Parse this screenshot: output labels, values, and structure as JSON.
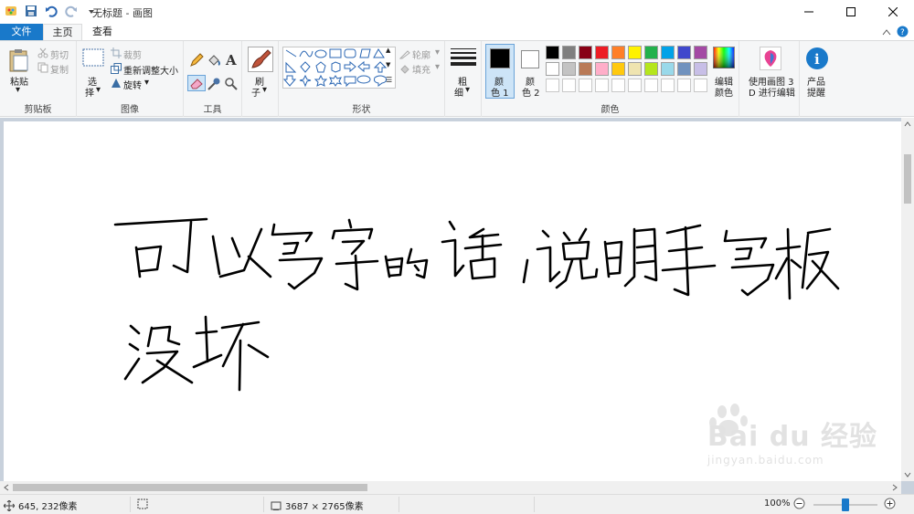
{
  "window": {
    "title": "无标题 - 画图"
  },
  "tabs": {
    "file": "文件",
    "home": "主页",
    "view": "查看"
  },
  "ribbon": {
    "clipboard": {
      "paste": "粘贴",
      "cut": "剪切",
      "copy": "复制",
      "label": "剪贴板"
    },
    "image": {
      "select": "选",
      "select2": "择",
      "crop": "裁剪",
      "resize": "重新调整大小",
      "rotate": "旋转",
      "label": "图像"
    },
    "tools": {
      "label": "工具",
      "brush": "刷",
      "brush2": "子"
    },
    "shapes": {
      "outline": "轮廓",
      "fill": "填充",
      "label": "形状"
    },
    "size": {
      "line1": "粗",
      "line2": "细"
    },
    "colors": {
      "color1a": "颜",
      "color1b": "色 1",
      "color2a": "颜",
      "color2b": "色 2",
      "edit_a": "编辑",
      "edit_b": "颜色",
      "label": "颜色",
      "palette_row1": [
        "#000000",
        "#7f7f7f",
        "#880015",
        "#ed1c24",
        "#ff7f27",
        "#fff200",
        "#22b14c",
        "#00a2e8",
        "#3f48cc",
        "#a349a4"
      ],
      "palette_row2": [
        "#ffffff",
        "#c3c3c3",
        "#b97a57",
        "#ffaec9",
        "#ffc90e",
        "#efe4b0",
        "#b5e61d",
        "#99d9ea",
        "#7092be",
        "#c8bfe7"
      ]
    },
    "paint3d": {
      "line1": "使用画图 3",
      "line2": "D 进行编辑"
    },
    "alert": {
      "line1": "产品",
      "line2": "提醒"
    }
  },
  "canvas": {
    "handwriting_line1": "可以写字的话,说明手写板",
    "handwriting_line2": "没坏"
  },
  "status": {
    "cursor": "645, 232像素",
    "image_size": "3687 × 2765像素",
    "zoom": "100%"
  },
  "watermark": {
    "brand": "Bai du 经验",
    "url": "jingyan.baidu.com"
  }
}
